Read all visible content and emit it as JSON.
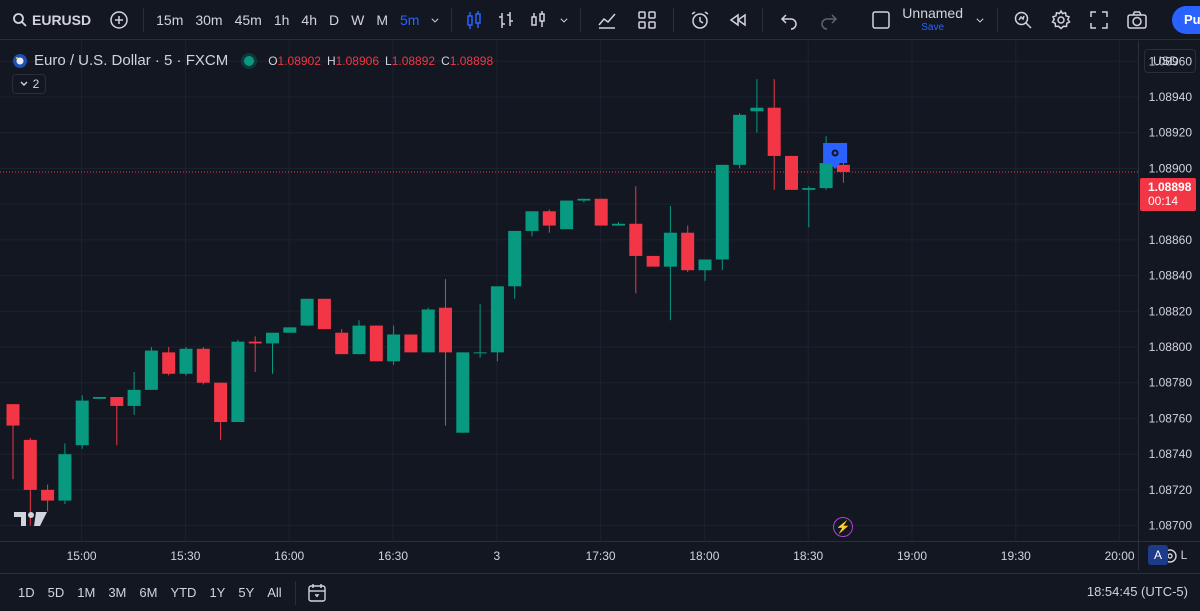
{
  "toolbar": {
    "symbol": "EURUSD",
    "intervals": [
      "15m",
      "30m",
      "45m",
      "1h",
      "4h",
      "D",
      "W",
      "M",
      "5m"
    ],
    "active_interval": "5m",
    "layout_name": "Unnamed",
    "layout_save": "Save",
    "publish_label": "Pu"
  },
  "legend": {
    "title": "Euro / U.S. Dollar · 5 · FXCM",
    "open_key": "O",
    "open": "1.08902",
    "high_key": "H",
    "high": "1.08906",
    "low_key": "L",
    "low": "1.08892",
    "close_key": "C",
    "close": "1.08898",
    "indicators_collapsed": "2"
  },
  "currency": "USD",
  "price_badge": {
    "price": "1.08898",
    "countdown": "00:14"
  },
  "scale_buttons": {
    "auto": "A",
    "log": "L"
  },
  "bottom": {
    "ranges": [
      "1D",
      "5D",
      "1M",
      "3M",
      "6M",
      "YTD",
      "1Y",
      "5Y",
      "All"
    ],
    "clock": "18:54:45 (UTC-5)"
  },
  "colors": {
    "up": "#089981",
    "down": "#f23645",
    "background": "#131722",
    "grid": "#1e222d",
    "accent": "#2962ff"
  },
  "chart_data": {
    "type": "candlestick",
    "y_ticks": [
      "1.08960",
      "1.08940",
      "1.08920",
      "1.08900",
      "1.08880",
      "1.08860",
      "1.08840",
      "1.08820",
      "1.08800",
      "1.08780",
      "1.08760",
      "1.08740",
      "1.08720",
      "1.08700"
    ],
    "ylim": [
      1.08688,
      1.08968
    ],
    "x_ticks": [
      {
        "label": "15:00",
        "index": 2
      },
      {
        "label": "15:30",
        "index": 8
      },
      {
        "label": "16:00",
        "index": 14
      },
      {
        "label": "16:30",
        "index": 20
      },
      {
        "label": "3",
        "index": 26
      },
      {
        "label": "17:30",
        "index": 32
      },
      {
        "label": "18:00",
        "index": 38
      },
      {
        "label": "18:30",
        "index": 44
      },
      {
        "label": "19:00",
        "index": 50
      },
      {
        "label": "19:30",
        "index": 56
      },
      {
        "label": "20:00",
        "index": 62
      }
    ],
    "last_price": 1.08898,
    "candles": [
      {
        "o": 1.08768,
        "h": 1.08768,
        "l": 1.08726,
        "c": 1.08756
      },
      {
        "o": 1.08748,
        "h": 1.08749,
        "l": 1.087,
        "c": 1.0872
      },
      {
        "o": 1.0872,
        "h": 1.08723,
        "l": 1.08708,
        "c": 1.08714
      },
      {
        "o": 1.08714,
        "h": 1.08746,
        "l": 1.08712,
        "c": 1.0874
      },
      {
        "o": 1.08745,
        "h": 1.08773,
        "l": 1.08743,
        "c": 1.0877
      },
      {
        "o": 1.08771,
        "h": 1.08772,
        "l": 1.08771,
        "c": 1.08772
      },
      {
        "o": 1.08772,
        "h": 1.08772,
        "l": 1.08745,
        "c": 1.08767
      },
      {
        "o": 1.08767,
        "h": 1.08786,
        "l": 1.08762,
        "c": 1.08776
      },
      {
        "o": 1.08776,
        "h": 1.088,
        "l": 1.08776,
        "c": 1.08798
      },
      {
        "o": 1.08797,
        "h": 1.088,
        "l": 1.08784,
        "c": 1.08785
      },
      {
        "o": 1.08785,
        "h": 1.088,
        "l": 1.08784,
        "c": 1.08799
      },
      {
        "o": 1.08799,
        "h": 1.088,
        "l": 1.08779,
        "c": 1.0878
      },
      {
        "o": 1.0878,
        "h": 1.0878,
        "l": 1.08748,
        "c": 1.08758
      },
      {
        "o": 1.08758,
        "h": 1.08804,
        "l": 1.08758,
        "c": 1.08803
      },
      {
        "o": 1.08803,
        "h": 1.08806,
        "l": 1.08786,
        "c": 1.08802
      },
      {
        "o": 1.08802,
        "h": 1.08808,
        "l": 1.08785,
        "c": 1.08808
      },
      {
        "o": 1.08808,
        "h": 1.08811,
        "l": 1.08808,
        "c": 1.08811
      },
      {
        "o": 1.08812,
        "h": 1.08827,
        "l": 1.08812,
        "c": 1.08827
      },
      {
        "o": 1.08827,
        "h": 1.08827,
        "l": 1.0881,
        "c": 1.0881
      },
      {
        "o": 1.08808,
        "h": 1.0881,
        "l": 1.08796,
        "c": 1.08796
      },
      {
        "o": 1.08796,
        "h": 1.08815,
        "l": 1.08796,
        "c": 1.08812
      },
      {
        "o": 1.08812,
        "h": 1.08812,
        "l": 1.08792,
        "c": 1.08792
      },
      {
        "o": 1.08792,
        "h": 1.08812,
        "l": 1.0879,
        "c": 1.08807
      },
      {
        "o": 1.08807,
        "h": 1.08807,
        "l": 1.08797,
        "c": 1.08797
      },
      {
        "o": 1.08797,
        "h": 1.08822,
        "l": 1.08797,
        "c": 1.08821
      },
      {
        "o": 1.08822,
        "h": 1.08838,
        "l": 1.08756,
        "c": 1.08797
      },
      {
        "o": 1.08752,
        "h": 1.08797,
        "l": 1.08752,
        "c": 1.08797
      },
      {
        "o": 1.08797,
        "h": 1.08824,
        "l": 1.08794,
        "c": 1.08797
      },
      {
        "o": 1.08797,
        "h": 1.08832,
        "l": 1.08792,
        "c": 1.08834
      },
      {
        "o": 1.08834,
        "h": 1.08865,
        "l": 1.08827,
        "c": 1.08865
      },
      {
        "o": 1.08865,
        "h": 1.08876,
        "l": 1.08862,
        "c": 1.08876
      },
      {
        "o": 1.08876,
        "h": 1.08877,
        "l": 1.08864,
        "c": 1.08868
      },
      {
        "o": 1.08866,
        "h": 1.08882,
        "l": 1.08866,
        "c": 1.08882
      },
      {
        "o": 1.08882,
        "h": 1.08883,
        "l": 1.08881,
        "c": 1.08883
      },
      {
        "o": 1.08883,
        "h": 1.08883,
        "l": 1.08868,
        "c": 1.08868
      },
      {
        "o": 1.08868,
        "h": 1.0887,
        "l": 1.08868,
        "c": 1.08869
      },
      {
        "o": 1.08869,
        "h": 1.0889,
        "l": 1.0883,
        "c": 1.08851
      },
      {
        "o": 1.08851,
        "h": 1.08851,
        "l": 1.08845,
        "c": 1.08845
      },
      {
        "o": 1.08845,
        "h": 1.08879,
        "l": 1.08815,
        "c": 1.08864
      },
      {
        "o": 1.08864,
        "h": 1.08868,
        "l": 1.08842,
        "c": 1.08843
      },
      {
        "o": 1.08843,
        "h": 1.08846,
        "l": 1.08837,
        "c": 1.08849
      },
      {
        "o": 1.08849,
        "h": 1.08902,
        "l": 1.08843,
        "c": 1.08902
      },
      {
        "o": 1.08902,
        "h": 1.08931,
        "l": 1.089,
        "c": 1.0893
      },
      {
        "o": 1.08932,
        "h": 1.0895,
        "l": 1.0892,
        "c": 1.08934
      },
      {
        "o": 1.08934,
        "h": 1.0895,
        "l": 1.08888,
        "c": 1.08907
      },
      {
        "o": 1.08907,
        "h": 1.08907,
        "l": 1.08888,
        "c": 1.08888
      },
      {
        "o": 1.08888,
        "h": 1.0889,
        "l": 1.08867,
        "c": 1.08889
      },
      {
        "o": 1.08889,
        "h": 1.08918,
        "l": 1.08888,
        "c": 1.08903
      },
      {
        "o": 1.08902,
        "h": 1.08906,
        "l": 1.08892,
        "c": 1.08898
      }
    ]
  }
}
